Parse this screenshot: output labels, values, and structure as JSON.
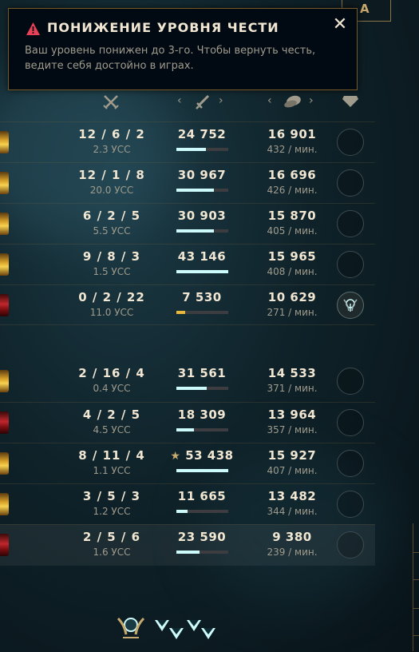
{
  "top_button": {
    "label": "А"
  },
  "toast": {
    "title": "ПОНИЖЕНИЕ УРОВНЯ ЧЕСТИ",
    "message": "Ваш уровень понижен до 3-го. Чтобы вернуть честь, ведите себя достойно в играх.",
    "close_label": "✕"
  },
  "header": {
    "kda_icon": "crossed-swords-icon",
    "damage_icon": "sword-icon",
    "gold_icon": "gold-coins-icon",
    "honor_icon": "honor-gem-icon",
    "prev_label": "‹",
    "next_label": "›"
  },
  "team1": [
    {
      "champ_color": "y",
      "kda": "12 / 6 / 2",
      "cs": "2.3 УСС",
      "damage": "24 752",
      "damage_ratio": 0.57,
      "gold": "16 901",
      "gold_rate": "432 / мин.",
      "honored": false
    },
    {
      "champ_color": "y",
      "kda": "12 / 1 / 8",
      "cs": "20.0 УСС",
      "damage": "30 967",
      "damage_ratio": 0.72,
      "gold": "16 696",
      "gold_rate": "426 / мин.",
      "honored": false
    },
    {
      "champ_color": "y",
      "kda": "6 / 2 / 5",
      "cs": "5.5 УСС",
      "damage": "30 903",
      "damage_ratio": 0.72,
      "gold": "15 870",
      "gold_rate": "405 / мин.",
      "honored": false
    },
    {
      "champ_color": "y",
      "kda": "9 / 8 / 3",
      "cs": "1.5 УСС",
      "damage": "43 146",
      "damage_ratio": 1.0,
      "gold": "15 965",
      "gold_rate": "408 / мин.",
      "honored": false
    },
    {
      "champ_color": "r",
      "kda": "0 / 2 / 22",
      "cs": "11.0 УСС",
      "damage": "7 530",
      "damage_ratio": 0.17,
      "damage_gold": true,
      "gold": "10 629",
      "gold_rate": "271 / мин.",
      "honored": true
    }
  ],
  "team2": [
    {
      "champ_color": "y",
      "kda": "2 / 16 / 4",
      "cs": "0.4 УСС",
      "damage": "31 561",
      "damage_ratio": 0.59,
      "gold": "14 533",
      "gold_rate": "371 / мин.",
      "honored": false
    },
    {
      "champ_color": "r",
      "kda": "4 / 2 / 5",
      "cs": "4.5 УСС",
      "damage": "18 309",
      "damage_ratio": 0.34,
      "gold": "13 964",
      "gold_rate": "357 / мин.",
      "honored": false
    },
    {
      "champ_color": "y",
      "kda": "8 / 11 / 4",
      "cs": "1.1 УСС",
      "damage": "53 438",
      "damage_star": "★",
      "damage_ratio": 1.0,
      "gold": "15 927",
      "gold_rate": "407 / мин.",
      "honored": false
    },
    {
      "champ_color": "y",
      "kda": "3 / 5 / 3",
      "cs": "1.2 УСС",
      "damage": "11 665",
      "damage_ratio": 0.22,
      "gold": "13 482",
      "gold_rate": "344 / мин.",
      "honored": false
    },
    {
      "champ_color": "r",
      "kda": "2 / 5 / 6",
      "cs": "1.6 УСС",
      "damage": "23 590",
      "damage_ratio": 0.44,
      "gold": "9 380",
      "gold_rate": "239 / мин.",
      "honored": false,
      "highlight": true
    }
  ],
  "footer": {
    "honor_emblem_icon": "honor-emblem-icon",
    "honor_level_icons": [
      "honor-gem-icon",
      "honor-gem-icon",
      "honor-gem-icon",
      "honor-gem-icon"
    ]
  }
}
